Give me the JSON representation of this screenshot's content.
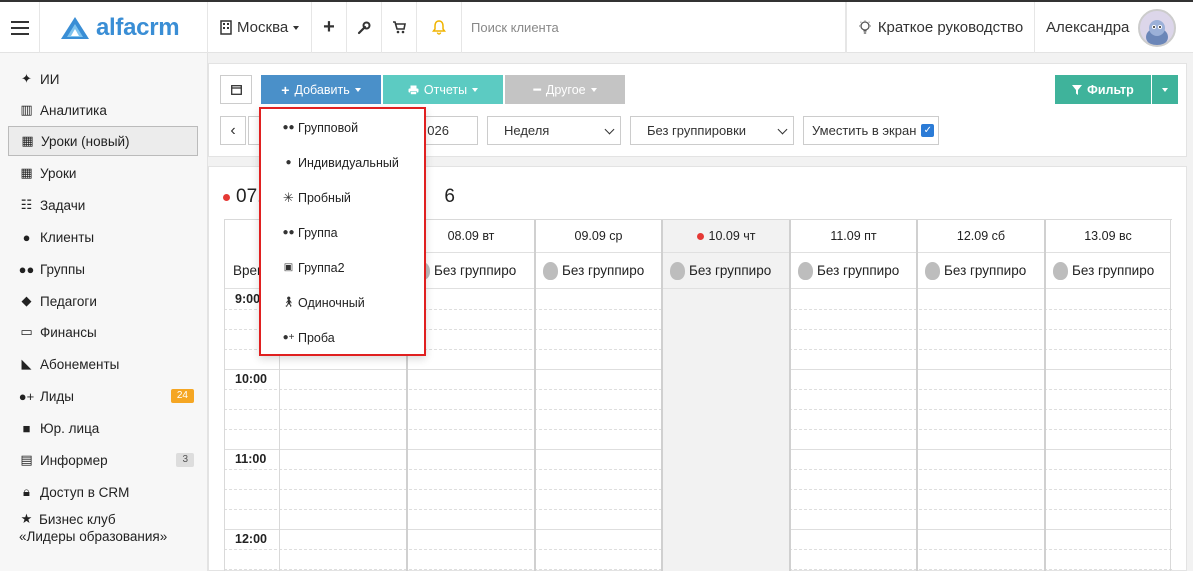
{
  "topbar": {
    "logo_text": "alfacrm",
    "city": "Москва",
    "search_placeholder": "Поиск клиента",
    "guide_label": "Краткое руководство",
    "user_name": "Александра"
  },
  "sidebar": {
    "items": [
      {
        "label": "ИИ",
        "icon": "sparkle-icon"
      },
      {
        "label": "Аналитика",
        "icon": "columns-icon"
      },
      {
        "label": "Уроки (новый)",
        "icon": "calendar-icon"
      },
      {
        "label": "Уроки",
        "icon": "calendar-icon"
      },
      {
        "label": "Задачи",
        "icon": "clipboard-icon"
      },
      {
        "label": "Клиенты",
        "icon": "user-icon"
      },
      {
        "label": "Группы",
        "icon": "users-icon"
      },
      {
        "label": "Педагоги",
        "icon": "graduation-cap-icon"
      },
      {
        "label": "Финансы",
        "icon": "money-icon"
      },
      {
        "label": "Абонементы",
        "icon": "tag-icon"
      },
      {
        "label": "Лиды",
        "icon": "user-plus-icon",
        "badge": "24"
      },
      {
        "label": "Юр. лица",
        "icon": "briefcase-icon"
      },
      {
        "label": "Информер",
        "icon": "book-icon",
        "badge": "3"
      },
      {
        "label": "Доступ в CRM",
        "icon": "lock-icon"
      },
      {
        "label": "Бизнес клуб",
        "label2": "«Лидеры образования»",
        "icon": "star-icon"
      }
    ]
  },
  "toolbar": {
    "add_label": "Добавить",
    "reports_label": "Отчеты",
    "other_label": "Другое",
    "filter_label": "Фильтр",
    "date_value": "026",
    "period_value": "Неделя",
    "grouping_value": "Без группировки",
    "fit_label": "Уместить в экран"
  },
  "dropdown": {
    "items": [
      {
        "label": "Групповой",
        "icon": "users-icon"
      },
      {
        "label": "Индивидуальный",
        "icon": "user-icon"
      },
      {
        "label": "Пробный",
        "icon": "asterisk-icon"
      },
      {
        "label": "Группа",
        "icon": "users-icon"
      },
      {
        "label": "Группа2",
        "icon": "id-card-icon"
      },
      {
        "label": "Одиночный",
        "icon": "walking-icon"
      },
      {
        "label": "Проба",
        "icon": "user-plus-icon"
      }
    ]
  },
  "calendar": {
    "week_title_prefix": "07.",
    "week_title_suffix": "6",
    "time_header": "Врем",
    "days": [
      {
        "label": "08.09 вт",
        "group": "Без группиро"
      },
      {
        "label": "09.09 ср",
        "group": "Без группиро"
      },
      {
        "label": "10.09 чт",
        "group": "Без группиро",
        "today": true
      },
      {
        "label": "11.09 пт",
        "group": "Без группиро"
      },
      {
        "label": "12.09 сб",
        "group": "Без группиро"
      },
      {
        "label": "13.09 вс",
        "group": "Без группиро"
      }
    ],
    "times": [
      "9:00",
      "10:00",
      "11:00",
      "12:00"
    ]
  },
  "colors": {
    "primary": "#4a90c9",
    "teal": "#5ccbc2",
    "filter_green": "#3fb39b",
    "highlight_red": "#e02020",
    "badge_orange": "#f5a623"
  }
}
